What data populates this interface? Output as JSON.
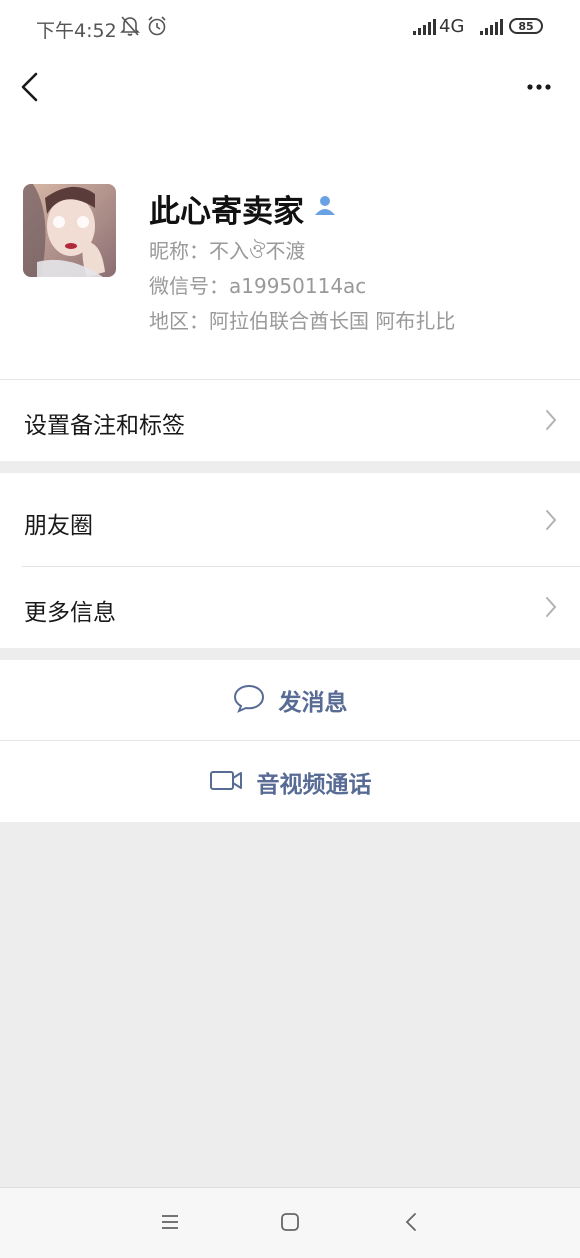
{
  "status_bar": {
    "time": "下午4:52",
    "network": "4G",
    "network_sub": "ıll",
    "battery": "85",
    "icons": [
      "mute-bell-icon",
      "alarm-clock-icon",
      "signal-icon",
      "battery-icon"
    ]
  },
  "nav": {
    "back_icon": "chevron-left-icon",
    "more_icon": "more-dots-icon"
  },
  "profile": {
    "name": "此心寄卖家",
    "nickname": "昵称：不入ঔ不渡",
    "wechat_id": "微信号：a19950114ac",
    "region": "地区：阿拉伯联合酋长国  阿布扎比",
    "badge_icon": "contact-person-icon"
  },
  "menu": {
    "remark_tags": "设置备注和标签",
    "moments": "朋友圈",
    "more_info": "更多信息"
  },
  "actions": {
    "message": "发消息",
    "video_call": "音视频通话"
  },
  "colors": {
    "link_blue": "#576b95",
    "background_gray": "#ededed",
    "secondary_text": "#999999"
  }
}
